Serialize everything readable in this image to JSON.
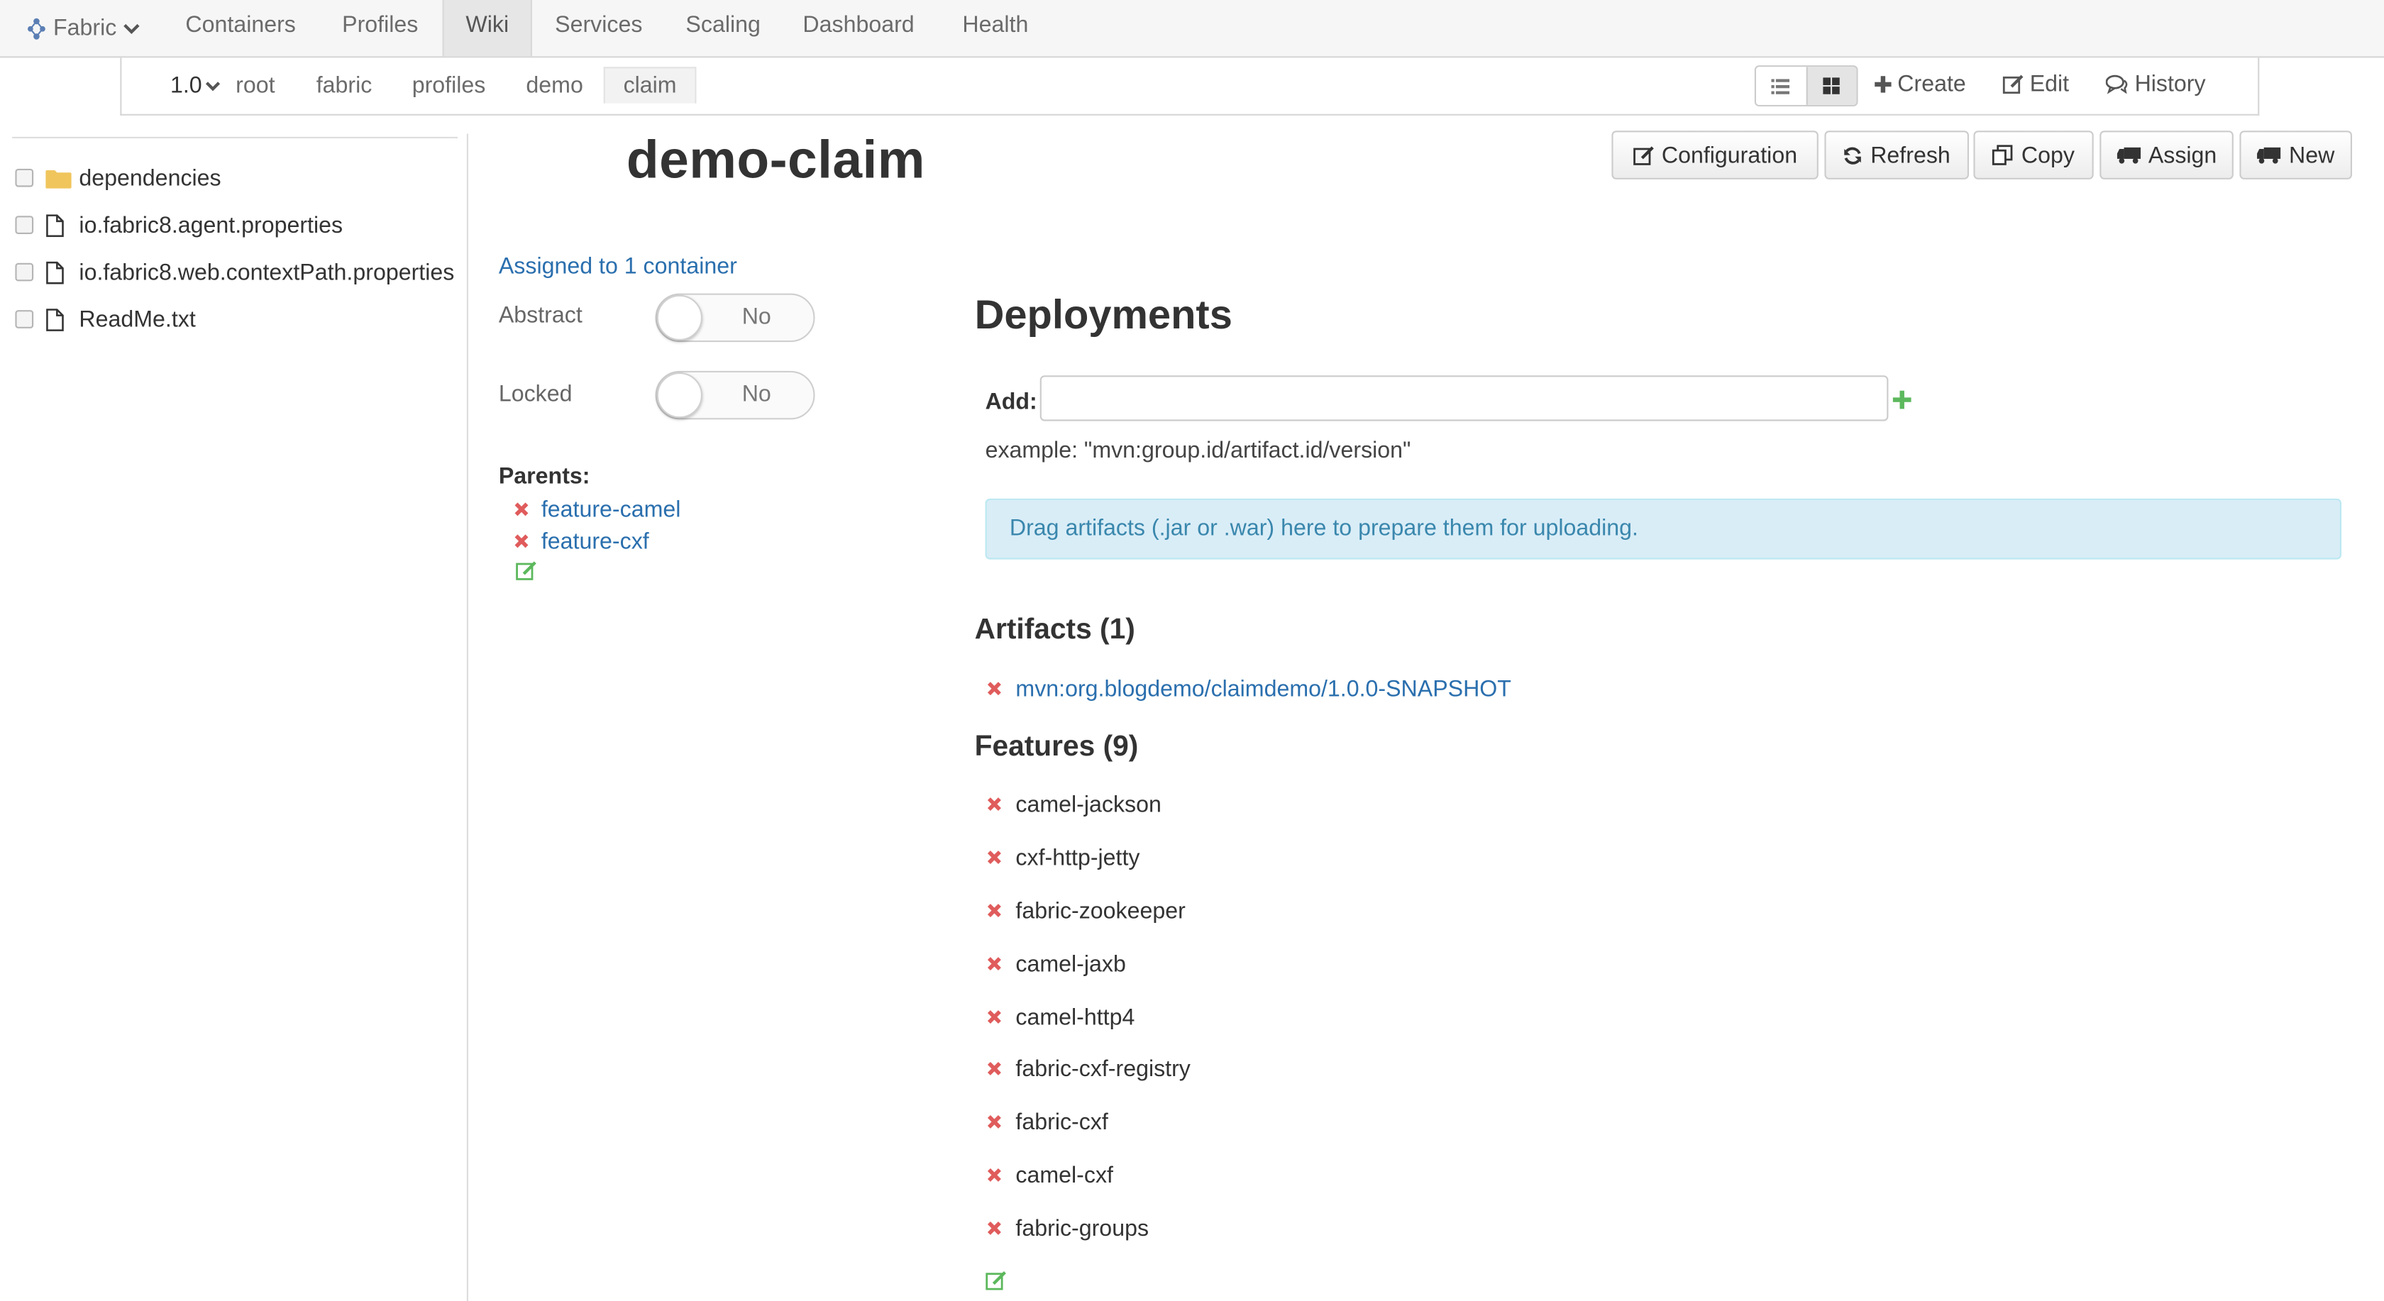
{
  "nav": {
    "brand": "Fabric",
    "items": [
      {
        "label": "Containers"
      },
      {
        "label": "Profiles"
      },
      {
        "label": "Wiki"
      },
      {
        "label": "Services"
      },
      {
        "label": "Scaling"
      },
      {
        "label": "Dashboard"
      },
      {
        "label": "Health"
      }
    ],
    "active": "Wiki"
  },
  "subnav": {
    "version": "1.0",
    "breadcrumbs": [
      "root",
      "fabric",
      "profiles",
      "demo",
      "claim"
    ],
    "active_crumb": "claim",
    "view_mode": "grid",
    "actions": {
      "create": "Create",
      "edit": "Edit",
      "history": "History"
    }
  },
  "tree": [
    {
      "name": "dependencies",
      "type": "folder"
    },
    {
      "name": "io.fabric8.agent.properties",
      "type": "file"
    },
    {
      "name": "io.fabric8.web.contextPath.properties",
      "type": "file"
    },
    {
      "name": "ReadMe.txt",
      "type": "file"
    }
  ],
  "profile": {
    "title": "demo-claim",
    "assigned": "Assigned to 1 container",
    "abstract_label": "Abstract",
    "abstract_value": "No",
    "locked_label": "Locked",
    "locked_value": "No",
    "parents_label": "Parents:",
    "parents": [
      "feature-camel",
      "feature-cxf"
    ]
  },
  "buttons": {
    "configuration": "Configuration",
    "refresh": "Refresh",
    "copy": "Copy",
    "assign": "Assign",
    "new": "New"
  },
  "deployments": {
    "title": "Deployments",
    "add_label": "Add:",
    "add_value": "",
    "example": "example: \"mvn:group.id/artifact.id/version\"",
    "drop_text": "Drag artifacts (.jar or .war) here to prepare them for uploading.",
    "artifacts_title": "Artifacts (1)",
    "artifacts": [
      "mvn:org.blogdemo/claimdemo/1.0.0-SNAPSHOT"
    ],
    "features_title": "Features (9)",
    "features": [
      "camel-jackson",
      "cxf-http-jetty",
      "fabric-zookeeper",
      "camel-jaxb",
      "camel-http4",
      "fabric-cxf-registry",
      "fabric-cxf",
      "camel-cxf",
      "fabric-groups"
    ]
  },
  "colors": {
    "link": "#2a6fae",
    "remove": "#e05c5c",
    "add": "#5cb85c",
    "folder": "#f0c55c",
    "info_bg": "#d9edf7"
  }
}
